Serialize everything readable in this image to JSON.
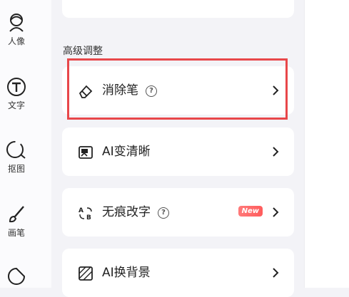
{
  "sidebar": {
    "items": [
      {
        "label": "人像",
        "icon": "portrait-icon"
      },
      {
        "label": "文字",
        "icon": "text-icon"
      },
      {
        "label": "抠图",
        "icon": "cutout-icon"
      },
      {
        "label": "画笔",
        "icon": "brush-icon"
      },
      {
        "label": "",
        "icon": "sticker-icon"
      }
    ]
  },
  "main": {
    "section_title": "高级调整",
    "tools": [
      {
        "label": "消除笔",
        "icon": "eraser-icon",
        "help": "?"
      },
      {
        "label": "AI变清晰",
        "icon": "hd-icon"
      },
      {
        "label": "无痕改字",
        "icon": "text-replace-icon",
        "help": "?",
        "badge": "New"
      },
      {
        "label": "AI换背景",
        "icon": "background-replace-icon"
      }
    ]
  },
  "colors": {
    "highlight": "#e8474a",
    "badge": "#ff5c5c",
    "background": "#f3f3f7"
  }
}
